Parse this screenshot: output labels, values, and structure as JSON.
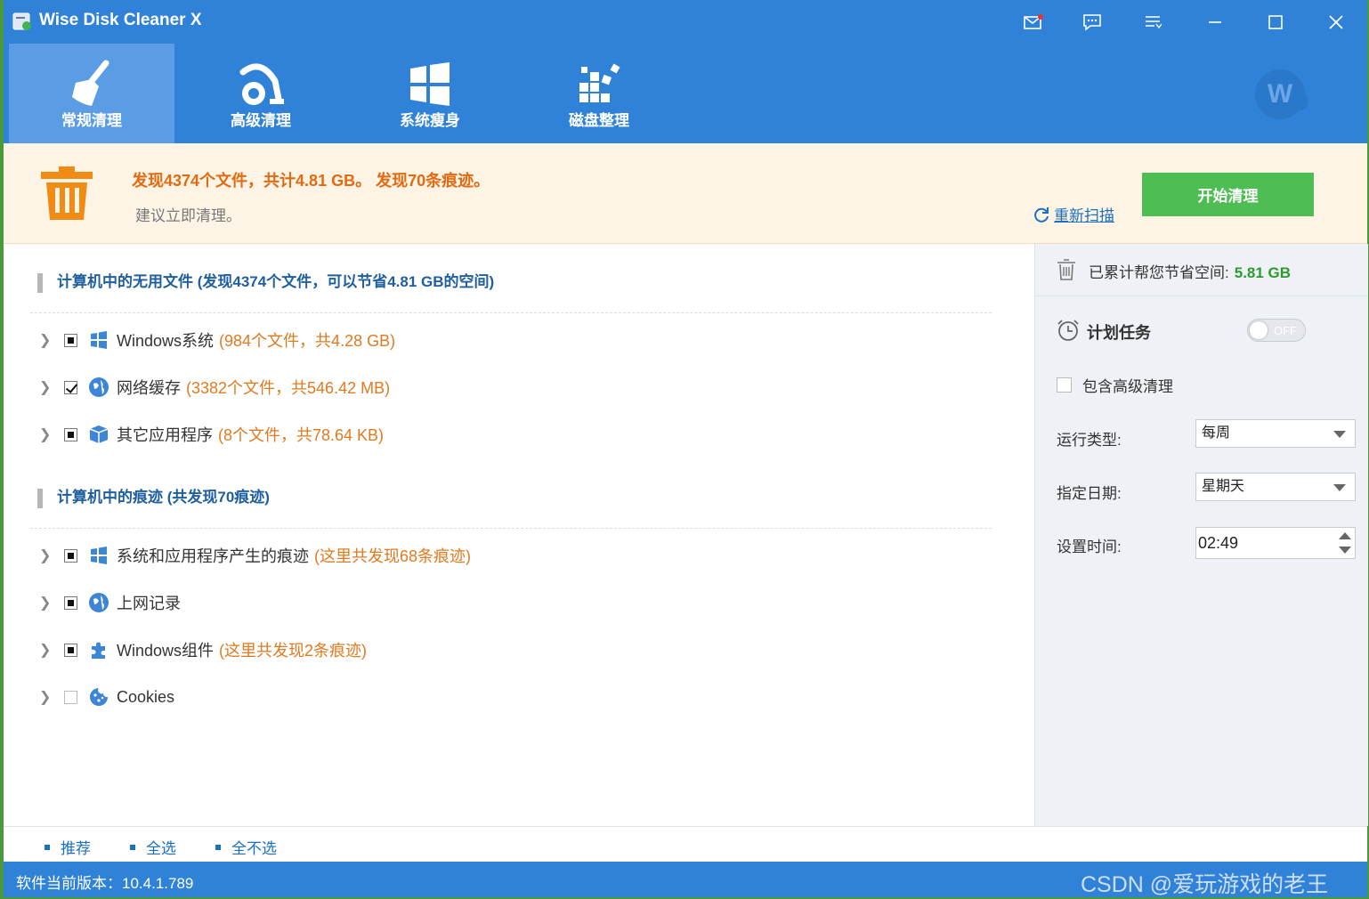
{
  "app": {
    "title": "Wise Disk Cleaner X"
  },
  "nav": {
    "tabs": [
      {
        "label": "常规清理",
        "icon": "broom-icon",
        "active": true
      },
      {
        "label": "高级清理",
        "icon": "vacuum-icon",
        "active": false
      },
      {
        "label": "系统瘦身",
        "icon": "windows-icon",
        "active": false
      },
      {
        "label": "磁盘整理",
        "icon": "defrag-icon",
        "active": false
      }
    ],
    "avatar_letter": "W"
  },
  "banner": {
    "main_text": "发现4374个文件，共计4.81 GB。 发现70条痕迹。",
    "sub_text": "建议立即清理。",
    "rescan_label": "重新扫描",
    "start_label": "开始清理"
  },
  "sections": [
    {
      "title": "计算机中的无用文件 (发现4374个文件，可以节省4.81 GB的空间)",
      "items": [
        {
          "label": "Windows系统",
          "extra": "(984个文件，共4.28 GB)",
          "state": "partial",
          "icon": "windows-icon"
        },
        {
          "label": "网络缓存",
          "extra": "(3382个文件，共546.42 MB)",
          "state": "checked",
          "icon": "globe-icon"
        },
        {
          "label": "其它应用程序",
          "extra": "(8个文件，共78.64 KB)",
          "state": "partial",
          "icon": "box-icon"
        }
      ]
    },
    {
      "title": "计算机中的痕迹 (共发现70痕迹)",
      "items": [
        {
          "label": "系统和应用程序产生的痕迹",
          "extra": "(这里共发现68条痕迹)",
          "state": "partial",
          "icon": "windows-icon"
        },
        {
          "label": "上网记录",
          "extra": "",
          "state": "partial",
          "icon": "globe-icon"
        },
        {
          "label": "Windows组件",
          "extra": "(这里共发现2条痕迹)",
          "state": "partial",
          "icon": "puzzle-icon"
        },
        {
          "label": "Cookies",
          "extra": "",
          "state": "empty",
          "icon": "cookie-icon"
        }
      ]
    }
  ],
  "right": {
    "saved_label": "已累计帮您节省空间:",
    "saved_value": "5.81 GB",
    "schedule_title": "计划任务",
    "toggle_label": "OFF",
    "include_adv_label": "包含高级清理",
    "run_type_label": "运行类型:",
    "run_type_value": "每周",
    "date_label": "指定日期:",
    "date_value": "星期天",
    "time_label": "设置时间:",
    "time_value": "02:49"
  },
  "bottom": {
    "recommend": "推荐",
    "select_all": "全选",
    "select_none": "全不选"
  },
  "status": {
    "version": "软件当前版本：10.4.1.789"
  },
  "watermark": "CSDN @爱玩游戏的老王",
  "colors": {
    "primary_blue": "#2f82d7",
    "start_green": "#4fbe52",
    "orange": "#e26a10"
  }
}
